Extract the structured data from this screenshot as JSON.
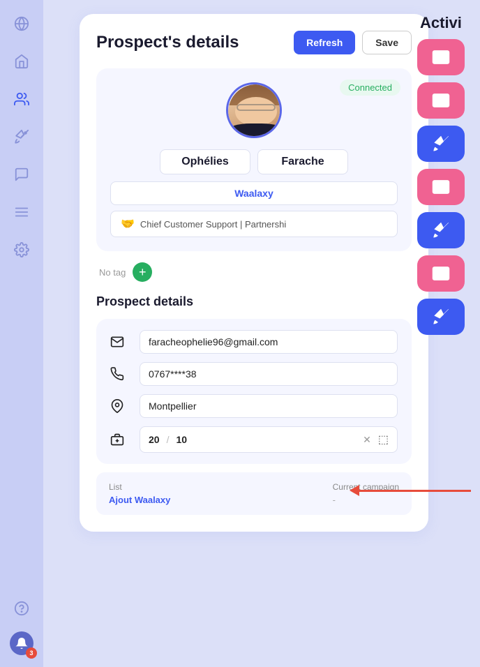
{
  "sidebar": {
    "items": [
      {
        "name": "globe-icon",
        "symbol": "🌐"
      },
      {
        "name": "home-icon",
        "symbol": "🏠"
      },
      {
        "name": "users-icon",
        "symbol": "👥"
      },
      {
        "name": "rocket-icon",
        "symbol": "🚀"
      },
      {
        "name": "chat-icon",
        "symbol": "💬"
      },
      {
        "name": "list-icon",
        "symbol": "≡"
      },
      {
        "name": "settings-icon",
        "symbol": "⚙"
      },
      {
        "name": "help-icon",
        "symbol": "?"
      }
    ],
    "notification_count": "3"
  },
  "header": {
    "title": "Prospect's details",
    "refresh_label": "Refresh",
    "save_label": "Save"
  },
  "profile": {
    "connected_status": "Connected",
    "first_name": "Ophélies",
    "last_name": "Farache",
    "company": "Waalaxy",
    "role": "Chief Customer Support | Partnershi"
  },
  "tags": {
    "no_tag_label": "No tag"
  },
  "prospect_details": {
    "section_title": "Prospect details",
    "email": "faracheophelie96@gmail.com",
    "phone": "0767****38",
    "location": "Montpellier",
    "score_current": "20",
    "score_separator": "/",
    "score_max": "10"
  },
  "list_info": {
    "list_label": "List",
    "list_value": "Ajout Waalaxy",
    "campaign_label": "Current campaign",
    "campaign_value": "-"
  },
  "activity": {
    "title": "Activi"
  }
}
